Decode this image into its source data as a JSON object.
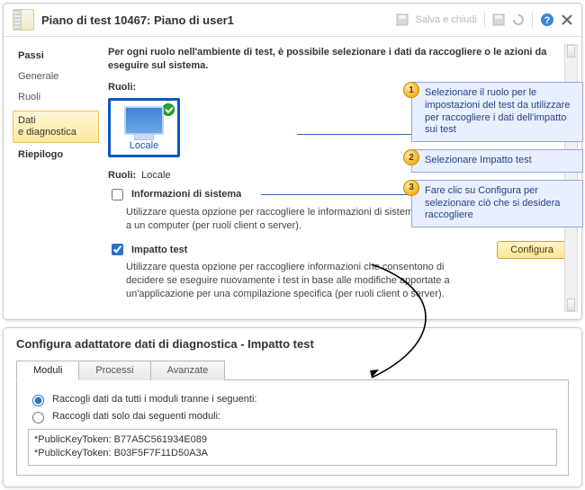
{
  "header": {
    "title": "Piano di test 10467: Piano di user1",
    "saveClose": "Salva e chiudi"
  },
  "sidebar": {
    "items": [
      {
        "label": "Passi"
      },
      {
        "label": "Generale"
      },
      {
        "label": "Ruoli"
      },
      {
        "label": "Dati\ne diagnostica"
      },
      {
        "label": "Riepilogo"
      }
    ]
  },
  "main": {
    "intro": "Per ogni ruolo nell'ambiente di test, è possibile selezionare i dati da raccogliere o le azioni da eseguire sul sistema.",
    "rolesLabel": "Ruoli:",
    "roleTile": "Locale",
    "rolesLine": {
      "label": "Ruoli:",
      "value": "Locale"
    },
    "opt1": {
      "title": "Informazioni di sistema",
      "desc": "Utilizzare questa opzione per raccogliere le informazioni di sistema relative a un computer (per ruoli client o server)."
    },
    "opt2": {
      "title": "Impatto test",
      "desc": "Utilizzare questa opzione per raccogliere informazioni che consentono di decidere se eseguire nuovamente i test in base alle modifiche apportate a un'applicazione per una compilazione specifica (per ruoli client o server).",
      "button": "Configura"
    }
  },
  "callouts": {
    "c1": "Selezionare il ruolo per le impostazioni del test da utilizzare per raccogliere i dati dell'impatto sui test",
    "c2": "Selezionare Impatto test",
    "c3": "Fare clic su Configura per selezionare ciò che si desidera raccogliere"
  },
  "dialog": {
    "title": "Configura adattatore dati di diagnostica - Impatto test",
    "tabs": [
      "Moduli",
      "Processi",
      "Avanzate"
    ],
    "radio1": "Raccogli dati da tutti i moduli tranne i seguenti:",
    "radio2": "Raccogli dati solo dai seguenti moduli:",
    "tokens": [
      "*PublicKeyToken: B77A5C561934E089",
      "*PublicKeyToken: B03F5F7F11D50A3A"
    ]
  }
}
